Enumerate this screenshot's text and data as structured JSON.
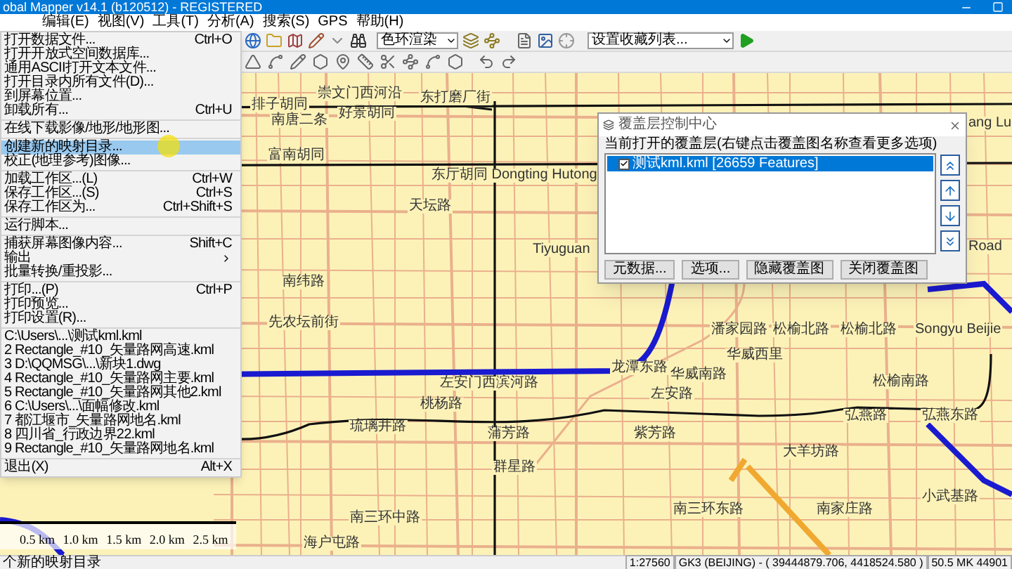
{
  "window": {
    "title": "obal Mapper v14.1 (b120512) - REGISTERED"
  },
  "menu_bar": [
    "编辑(E)",
    "视图(V)",
    "工具(T)",
    "分析(A)",
    "搜索(S)",
    "GPS",
    "帮助(H)"
  ],
  "toolbar": {
    "render_dropdown": "色环渲染",
    "favorites_dropdown": "设置收藏列表..."
  },
  "file_menu": [
    {
      "kind": "item",
      "label": "打开数据文件...",
      "shortcut": "Ctrl+O",
      "selected": false
    },
    {
      "kind": "item",
      "label": "打开开放式空间数据库...",
      "selected": false
    },
    {
      "kind": "item",
      "label": "通用ASCII打开文本文件...",
      "selected": false
    },
    {
      "kind": "item",
      "label": "打开目录内所有文件(D)...",
      "selected": false
    },
    {
      "kind": "item",
      "label": "到屏幕位置...",
      "selected": false
    },
    {
      "kind": "item",
      "label": "卸载所有...",
      "shortcut": "Ctrl+U",
      "selected": false
    },
    {
      "kind": "separator"
    },
    {
      "kind": "item",
      "label": "在线下载影像/地形/地形图...",
      "selected": false
    },
    {
      "kind": "separator"
    },
    {
      "kind": "item",
      "label": "创建新的映射目录...",
      "selected": true
    },
    {
      "kind": "item",
      "label": "校正(地理参考)图像...",
      "selected": false
    },
    {
      "kind": "separator"
    },
    {
      "kind": "item",
      "label": "加载工作区...(L)",
      "shortcut": "Ctrl+W",
      "selected": false
    },
    {
      "kind": "item",
      "label": "保存工作区...(S)",
      "shortcut": "Ctrl+S",
      "selected": false
    },
    {
      "kind": "item",
      "label": "保存工作区为...",
      "shortcut": "Ctrl+Shift+S",
      "selected": false
    },
    {
      "kind": "separator"
    },
    {
      "kind": "item",
      "label": "运行脚本...",
      "selected": false
    },
    {
      "kind": "separator"
    },
    {
      "kind": "item",
      "label": "捕获屏幕图像内容...",
      "shortcut": "Shift+C",
      "selected": false
    },
    {
      "kind": "submenu",
      "label": "输出",
      "selected": false
    },
    {
      "kind": "item",
      "label": "批量转换/重投影...",
      "selected": false
    },
    {
      "kind": "separator"
    },
    {
      "kind": "item",
      "label": "打印...(P)",
      "shortcut": "Ctrl+P",
      "selected": false
    },
    {
      "kind": "item",
      "label": "打印预览...",
      "selected": false
    },
    {
      "kind": "item",
      "label": "打印设置(R)...",
      "selected": false
    },
    {
      "kind": "separator"
    },
    {
      "kind": "item",
      "label": "C:\\Users\\...\\测试kml.kml",
      "selected": false
    },
    {
      "kind": "item",
      "label": "2 Rectangle_#10_矢量路网高速.kml",
      "selected": false
    },
    {
      "kind": "item",
      "label": "3 D:\\QQMSG\\...\\新块1.dwg",
      "selected": false
    },
    {
      "kind": "item",
      "label": "4 Rectangle_#10_矢量路网主要.kml",
      "selected": false
    },
    {
      "kind": "item",
      "label": "5 Rectangle_#10_矢量路网其他2.kml",
      "selected": false
    },
    {
      "kind": "item",
      "label": "6 C:\\Users\\...\\面幅修改.kml",
      "selected": false
    },
    {
      "kind": "item",
      "label": "7 都江堰市_矢量路网地名.kml",
      "selected": false
    },
    {
      "kind": "item",
      "label": "8 四川省_行政边界22.kml",
      "selected": false
    },
    {
      "kind": "item",
      "label": "9 Rectangle_#10_矢量路网地名.kml",
      "selected": false
    },
    {
      "kind": "separator"
    },
    {
      "kind": "item",
      "label": "退出(X)",
      "shortcut": "Alt+X",
      "selected": false
    }
  ],
  "overlay_dialog": {
    "title": "覆盖层控制中心",
    "caption": "当前打开的覆盖层(右键点击覆盖图名称查看更多选项)",
    "layers": [
      {
        "label": "测试kml.kml [26659 Features]",
        "checked": true,
        "selected": true
      }
    ],
    "buttons": [
      "元数据...",
      "选项...",
      "隐藏覆盖图",
      "关闭覆盖图"
    ]
  },
  "map_labels": [
    "排子胡同",
    "崇文门西河沿",
    "东打磨厂街",
    "南唐二条",
    "好景胡同",
    "富南胡同",
    "东厅胡同 Dongting Hutong",
    "天坛路",
    "Tiyuguan",
    "南纬路",
    "先农坛前街",
    "左安门西滨河路",
    "桃杨路",
    "琉璃井路",
    "蒲芳路",
    "群星路",
    "南三环中路",
    "海户屯路",
    "ang Lu",
    "Road",
    "潘家园路",
    "松榆北路",
    "松榆北路",
    "Songyu Beijie",
    "华威西里",
    "龙潭东路",
    "华威南路",
    "松榆南路",
    "左安路",
    "弘燕路",
    "弘燕东路",
    "紫芳路",
    "大羊坊路",
    "南三环东路",
    "南家庄路",
    "小武基路"
  ],
  "scale_bar": [
    "0.5 km",
    "1.0 km",
    "1.5 km",
    "2.0 km",
    "2.5 km"
  ],
  "status_bar": {
    "message": "个新的映射目录",
    "scale": "1:27560",
    "coordinates": "GK3 (BEIJING) - ( 39444879.706, 4418524.580 )",
    "extra": "50.5 MK 44901"
  }
}
